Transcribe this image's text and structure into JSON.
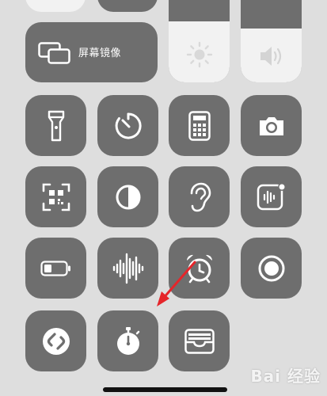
{
  "screen_mirroring": {
    "label": "屏幕镜像",
    "icon": "screen-mirroring-icon"
  },
  "sliders": {
    "brightness": {
      "level": 0.62,
      "icon": "sun-icon"
    },
    "volume": {
      "level": 0.55,
      "icon": "speaker-icon"
    }
  },
  "controls": [
    {
      "name": "flashlight",
      "icon": "flashlight-icon"
    },
    {
      "name": "timer",
      "icon": "timer-icon"
    },
    {
      "name": "calculator",
      "icon": "calculator-icon"
    },
    {
      "name": "camera",
      "icon": "camera-icon"
    },
    {
      "name": "code-scanner",
      "icon": "qr-scanner-icon"
    },
    {
      "name": "dark-mode",
      "icon": "dark-mode-icon"
    },
    {
      "name": "hearing",
      "icon": "ear-icon"
    },
    {
      "name": "voice-memo",
      "icon": "voice-memo-icon"
    },
    {
      "name": "low-power-mode",
      "icon": "battery-icon"
    },
    {
      "name": "sound-recognition",
      "icon": "waveform-icon"
    },
    {
      "name": "alarm",
      "icon": "alarm-clock-icon"
    },
    {
      "name": "screen-recording",
      "icon": "record-icon"
    },
    {
      "name": "shazam",
      "icon": "shazam-icon"
    },
    {
      "name": "stopwatch",
      "icon": "stopwatch-icon"
    },
    {
      "name": "wallet",
      "icon": "wallet-icon"
    }
  ],
  "annotation": {
    "arrow_color": "#e5252a",
    "target": "stopwatch"
  },
  "watermark": {
    "text": "Bai 经验",
    "logo": "baidu-paw-icon"
  },
  "colors": {
    "tile": "#6e6e6e",
    "background": "#dedede",
    "slider_fill": "#f2f2f2"
  }
}
